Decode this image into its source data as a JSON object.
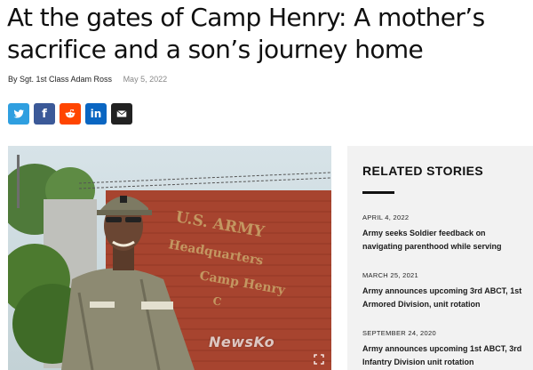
{
  "article": {
    "headline": "At the gates of Camp Henry: A mother’s sacrifice and a son’s journey home",
    "author": "By Sgt. 1st Class Adam Ross",
    "date": "May 5, 2022"
  },
  "share": [
    {
      "name": "twitter",
      "icon": "twitter-icon",
      "color": "#2f9fe0"
    },
    {
      "name": "facebook",
      "icon": "facebook-icon",
      "color": "#3b5998"
    },
    {
      "name": "reddit",
      "icon": "reddit-icon",
      "color": "#ff4500"
    },
    {
      "name": "linkedin",
      "icon": "linkedin-icon",
      "color": "#0a66c2"
    },
    {
      "name": "email",
      "icon": "email-icon",
      "color": "#222222"
    }
  ],
  "photo": {
    "watermark": "NewsKo"
  },
  "related": {
    "heading": "RELATED STORIES",
    "stories": [
      {
        "date": "APRIL 4, 2022",
        "title": "Army seeks Soldier feedback on navigating parenthood while serving"
      },
      {
        "date": "MARCH 25, 2021",
        "title": "Army announces upcoming 3rd ABCT, 1st Armored Division, unit rotation"
      },
      {
        "date": "SEPTEMBER 24, 2020",
        "title": "Army announces upcoming 1st ABCT, 3rd Infantry Division unit rotation"
      }
    ]
  }
}
